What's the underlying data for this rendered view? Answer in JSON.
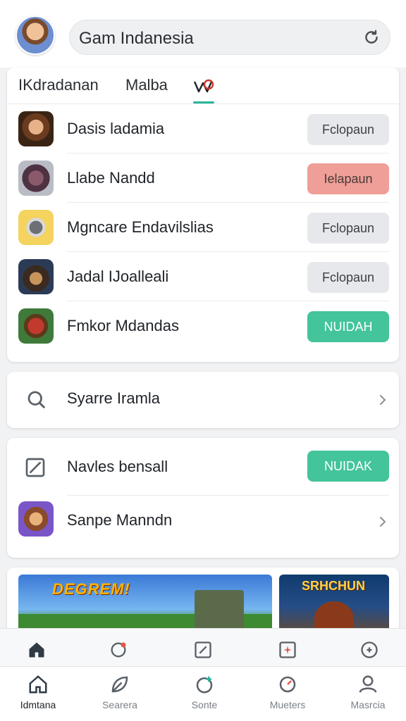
{
  "header": {
    "search_text": "Gam Indanesia"
  },
  "tabs": [
    {
      "label": "IKdradanan"
    },
    {
      "label": "Malba"
    }
  ],
  "list": [
    {
      "title": "Dasis ladamia",
      "action": "Fclopaun"
    },
    {
      "title": "Llabe Nandd",
      "action": "Ielapaun"
    },
    {
      "title": "Mgncare Endavilslias",
      "action": "Fclopaun"
    },
    {
      "title": "Jadal IJoalleali",
      "action": "Fclopaun"
    },
    {
      "title": "Fmkor Mdandas",
      "action": "NUIDAH"
    }
  ],
  "search_card": {
    "label": "Syarre Iramla"
  },
  "news_card": {
    "row1_label": "Navles bensall",
    "row1_action": "NUIDAK",
    "row2_label": "Sanpe Manndn"
  },
  "banners": {
    "left_title": "DEGREM!",
    "right_title": "SRHCHUN"
  },
  "bottom_nav": [
    {
      "label": "Idmtana"
    },
    {
      "label": "Searera"
    },
    {
      "label": "Sonte"
    },
    {
      "label": "Mueters"
    },
    {
      "label": "Masrcia"
    }
  ],
  "colors": {
    "accent_green": "#43c49b",
    "accent_red": "#ef9f98",
    "tab_underline": "#2bb59a"
  }
}
